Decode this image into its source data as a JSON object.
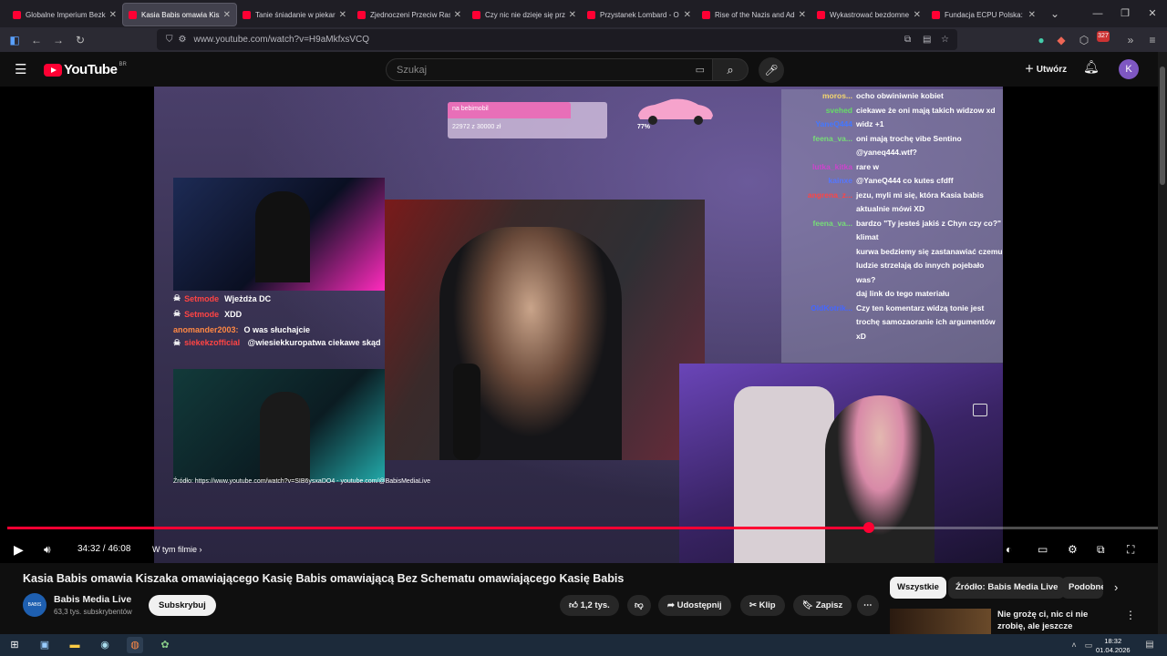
{
  "browser": {
    "tabs": [
      {
        "title": "Globalne Imperium Bezk"
      },
      {
        "title": "Kasia Babis omawia Kisza"
      },
      {
        "title": "Tanie śniadanie w piekar"
      },
      {
        "title": "Zjednoczeni Przeciw Rasi"
      },
      {
        "title": "Czy nic nie dzieje się przy"
      },
      {
        "title": "Przystanek Lombard - O"
      },
      {
        "title": "Rise of the Nazis and Ad"
      },
      {
        "title": "Wykastrować bezdomne"
      },
      {
        "title": "Fundacja ECPU Polska: Ł"
      }
    ],
    "url": "www.youtube.com/watch?v=H9aMkfxsVCQ",
    "badge_count": "327"
  },
  "youtube": {
    "logo_text": "YouTube",
    "country_code": "BR",
    "search_placeholder": "Szukaj",
    "create_label": "Utwórz",
    "avatar_letter": "K"
  },
  "video_overlay": {
    "donation_label": "na bebimobil",
    "donation_amount": "22972 z 30000 zł",
    "donation_percent": "77%",
    "donation_fraction": 0.77,
    "chat_left": [
      {
        "user": "Setmode",
        "text": "Wjeżdża DC",
        "color": "#ff4444"
      },
      {
        "user": "Setmode",
        "text": "XDD",
        "color": "#ff4444"
      },
      {
        "user": "anomander2003:",
        "text": "O was słuchajcie",
        "color": "#ff8844"
      },
      {
        "user": "siekekzofficial",
        "text": "@wiesiekkuropatwa ciekawe skąd",
        "color": "#ff4444"
      }
    ],
    "source_text": "Źródło: https://www.youtube.com/watch?v=SIB6ysxaDO4 - youtube.com/@BabisMediaLive",
    "chat_right": [
      {
        "user": "moros...",
        "text": "ocho obwiniwnie kobiet",
        "color": "#f5d76e"
      },
      {
        "user": "svehed",
        "text": "ciekawe że oni mają takich widzow xd",
        "color": "#66dd66"
      },
      {
        "user": "YaneQ444",
        "text": "widz +1",
        "color": "#4477ff"
      },
      {
        "user": "feena_va...",
        "text": "oni mają trochę vibe Sentino",
        "color": "#77dd77"
      },
      {
        "user": "",
        "text": "@yaneq444.wtf?",
        "color": "#4477ff"
      },
      {
        "user": "lutka_kitka",
        "text": "rare w",
        "color": "#cc44cc"
      },
      {
        "user": "kainxe",
        "text": "@YaneQ444 co kutes cfdff",
        "color": "#5577ff"
      },
      {
        "user": "angrena_z...",
        "text": "jezu, myli mi się, która Kasia babis aktualnie mówi XD",
        "color": "#ff4444"
      },
      {
        "user": "feena_va...",
        "text": "bardzo \"Ty jesteś jakiś z Chyn czy co?\" klimat",
        "color": "#77dd77"
      },
      {
        "user": "",
        "text": "kurwa bedziemy się zastanawiać czemu ludzie strzelają do innych pojebało was?",
        "color": "#9944ff"
      },
      {
        "user": "",
        "text": "daj link do tego materiału",
        "color": "#ff4444"
      },
      {
        "user": "OldKotrik...",
        "text": "Czy ten komentarz widzą tonie jest trochę samozaoranie ich argumentów xD",
        "color": "#4466ff"
      }
    ]
  },
  "player": {
    "current_time": "34:32",
    "separator": " / ",
    "duration": "46:08",
    "progress": 0.748,
    "chapters_label": "W tym filmie"
  },
  "video": {
    "title": "Kasia Babis omawia Kiszaka omawiającego Kasię Babis omawiającą Bez Schematu omawiającego Kasię Babis",
    "channel_name": "Babis Media Live",
    "subscribers": "63,3 tys. subskrybentów",
    "subscribe_label": "Subskrybuj",
    "likes": "1,2 tys.",
    "share_label": "Udostępnij",
    "clip_label": "Klip",
    "save_label": "Zapisz"
  },
  "sidebar": {
    "chips": [
      "Wszystkie",
      "Źródło: Babis Media Live",
      "Podobne"
    ],
    "rec_title": "Nie grożę ci, nic ci nie zrobię, ale jeszcze zobaczysz w ..."
  },
  "taskbar": {
    "time": "18:32",
    "date": "01.04.2026"
  }
}
